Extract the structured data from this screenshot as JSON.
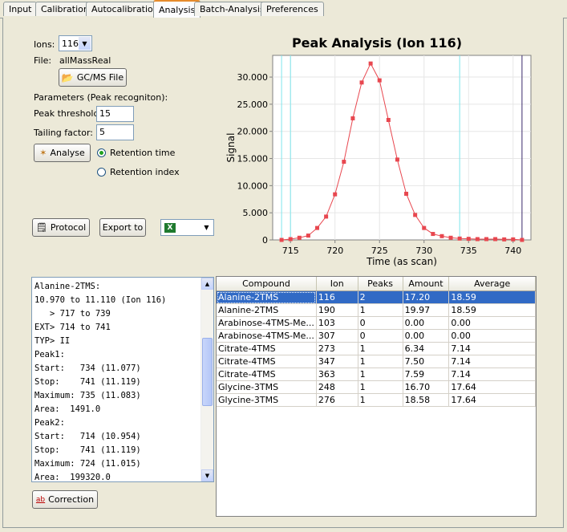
{
  "tabs": [
    {
      "label": "Input"
    },
    {
      "label": "Calibration"
    },
    {
      "label": "Autocalibration"
    },
    {
      "label": "Analysis"
    },
    {
      "label": "Batch-Analysis"
    },
    {
      "label": "Preferences"
    }
  ],
  "controls": {
    "ions_label": "Ions:",
    "ions_value": "116",
    "file_label": "File:",
    "file_value": "allMassReal",
    "gcms_button": "GC/MS File",
    "params_label": "Parameters (Peak recogniton):",
    "peak_threshold_label": "Peak threshold:",
    "peak_threshold_value": "15",
    "tailing_label": "Tailing factor:",
    "tailing_value": "5",
    "analyse_button": "Analyse",
    "retention_time_label": "Retention time",
    "retention_index_label": "Retention index",
    "protocol_button": "Protocol",
    "export_button": "Export to",
    "correction_button": "Correction"
  },
  "log_lines": [
    "Alanine-2TMS:",
    "10.970 to 11.110 (Ion 116)",
    "   > 717 to 739",
    "EXT> 714 to 741",
    "TYP> II",
    "Peak1:",
    "Start:   734 (11.077)",
    "Stop:    741 (11.119)",
    "Maximum: 735 (11.083)",
    "Area:  1491.0",
    "Peak2:",
    "Start:   714 (10.954)",
    "Stop:    741 (11.119)",
    "Maximum: 724 (11.015)",
    "Area:  199320.0"
  ],
  "table": {
    "columns": [
      "Compound",
      "Ion",
      "Peaks",
      "Amount",
      "Average"
    ],
    "rows": [
      [
        "Alanine-2TMS",
        "116",
        "2",
        "17.20",
        "18.59"
      ],
      [
        "Alanine-2TMS",
        "190",
        "1",
        "19.97",
        "18.59"
      ],
      [
        "Arabinose-4TMS-Me...",
        "103",
        "0",
        "0.00",
        "0.00"
      ],
      [
        "Arabinose-4TMS-Me...",
        "307",
        "0",
        "0.00",
        "0.00"
      ],
      [
        "Citrate-4TMS",
        "273",
        "1",
        "6.34",
        "7.14"
      ],
      [
        "Citrate-4TMS",
        "347",
        "1",
        "7.50",
        "7.14"
      ],
      [
        "Citrate-4TMS",
        "363",
        "1",
        "7.59",
        "7.14"
      ],
      [
        "Glycine-3TMS",
        "248",
        "1",
        "16.70",
        "17.64"
      ],
      [
        "Glycine-3TMS",
        "276",
        "1",
        "18.58",
        "17.64"
      ]
    ]
  },
  "chart_data": {
    "type": "line",
    "title": "Peak Analysis (Ion 116)",
    "xlabel": "Time (as scan)",
    "ylabel": "Signal",
    "xlim": [
      713,
      742
    ],
    "ylim": [
      0,
      34000
    ],
    "xticks": [
      715,
      720,
      725,
      730,
      735,
      740
    ],
    "yticks": [
      0,
      5000,
      10000,
      15000,
      20000,
      25000,
      30000
    ],
    "ytick_labels": [
      "0",
      "5.000",
      "10.000",
      "15.000",
      "20.000",
      "25.000",
      "30.000"
    ],
    "vlines": [
      714,
      715,
      734,
      741
    ],
    "series": [
      {
        "color": "#e8474f",
        "x": [
          714,
          715,
          716,
          717,
          718,
          719,
          720,
          721,
          722,
          723,
          724,
          725,
          726,
          727,
          728,
          729,
          730,
          731,
          732,
          733,
          734,
          735,
          736,
          737,
          738,
          739,
          740,
          741
        ],
        "y": [
          0,
          150,
          400,
          800,
          2200,
          4300,
          8400,
          14400,
          22400,
          29000,
          32500,
          29400,
          22100,
          14800,
          8500,
          4600,
          2200,
          1100,
          700,
          400,
          250,
          200,
          150,
          150,
          150,
          100,
          100,
          0
        ]
      }
    ]
  }
}
